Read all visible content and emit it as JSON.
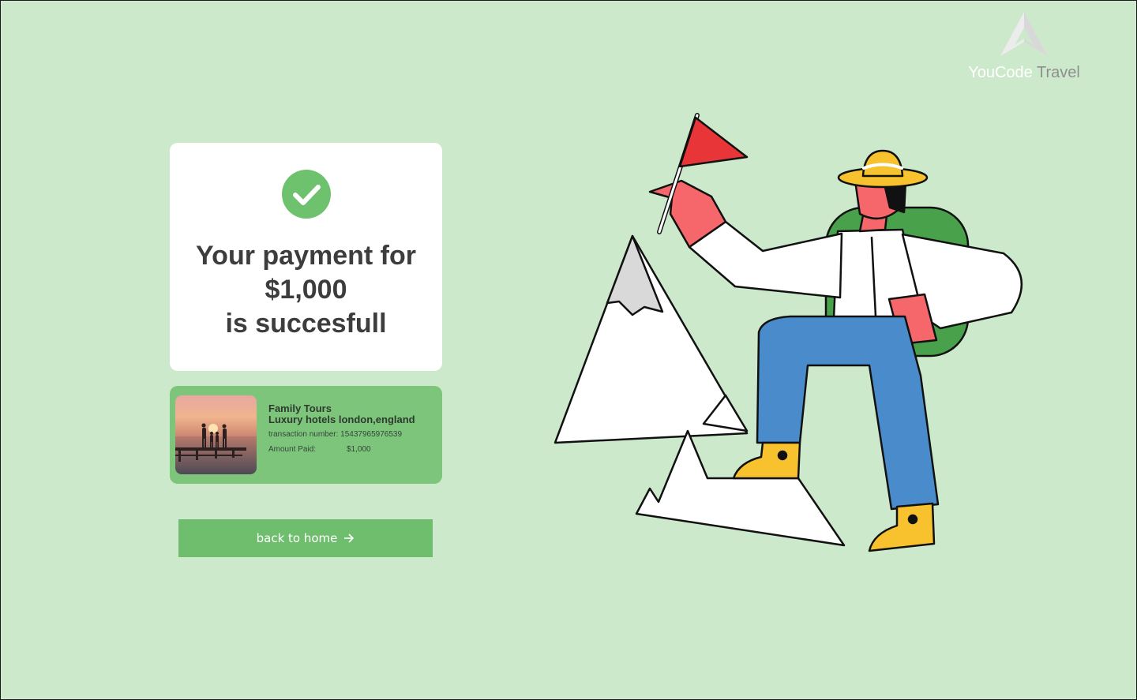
{
  "brand": {
    "name_part1": "YouCode",
    "name_part2": "Travel",
    "logo_icon": "mountain-logo-icon"
  },
  "payment": {
    "line1": "Your payment for",
    "amount": "$1,000",
    "line3": "is succesfull",
    "status_icon": "check-circle-icon"
  },
  "tour": {
    "title": "Family Tours",
    "subtitle": "Luxury hotels london,england",
    "transaction_label": "transaction number:",
    "transaction_number": "15437965976539",
    "amount_label": "Amount Paid:",
    "amount_value": "$1,000",
    "photo": "family-at-sunset-pier-photo"
  },
  "actions": {
    "back_home_label": "back to home",
    "back_home_icon": "arrow-right-icon"
  },
  "illustration": "hiker-with-flag-on-mountains-illustration",
  "colors": {
    "background": "#cde9cb",
    "accent_green": "#6fbe6d",
    "card_green": "#7dc57b",
    "text_dark": "#3d3d3d"
  }
}
